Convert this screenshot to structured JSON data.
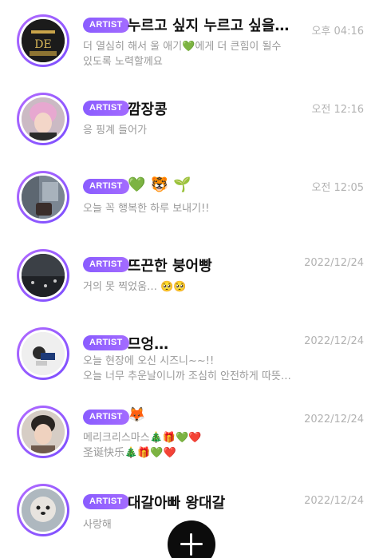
{
  "feed": {
    "items": [
      {
        "badge": "ARTIST",
        "name": "누르고 싶지 누르고 싶을…",
        "time": "오후 04:16",
        "message_line1": "더 열심히 해서 울 애기💚에게 더 큰힘이 될수",
        "message_line2": "있도록 노력할께요"
      },
      {
        "badge": "ARTIST",
        "name": "깜장콩",
        "time": "오전 12:16",
        "message_line1": "응 핑계 들어가",
        "message_line2": ""
      },
      {
        "badge": "ARTIST",
        "name": "💚 🐯 🌱",
        "time": "오전 12:05",
        "message_line1": "오늘 꼭 행복한 하루 보내기!!",
        "message_line2": ""
      },
      {
        "badge": "ARTIST",
        "name": "뜨끈한 붕어빵",
        "time": "2022/12/24",
        "message_line1": "거의 못 찍었움… 🥺🥺",
        "message_line2": ""
      },
      {
        "badge": "ARTIST",
        "name": "므엉…",
        "time": "2022/12/24",
        "message_line1": "오늘 현장에 오신 시즈니~~!!",
        "message_line2": "오늘 너무 추운날이니까 조심히 안전하게 따뜻…"
      },
      {
        "badge": "ARTIST",
        "name": "🦊",
        "time": "2022/12/24",
        "message_line1": "메리크리스마스🎄🎁💚❤️",
        "message_line2": "圣诞快乐🎄🎁💚❤️"
      },
      {
        "badge": "ARTIST",
        "name": "대갈아빠 왕대갈",
        "time": "2022/12/24",
        "message_line1": "사랑해",
        "message_line2": ""
      }
    ]
  },
  "fab": {
    "icon": "plus-icon"
  }
}
